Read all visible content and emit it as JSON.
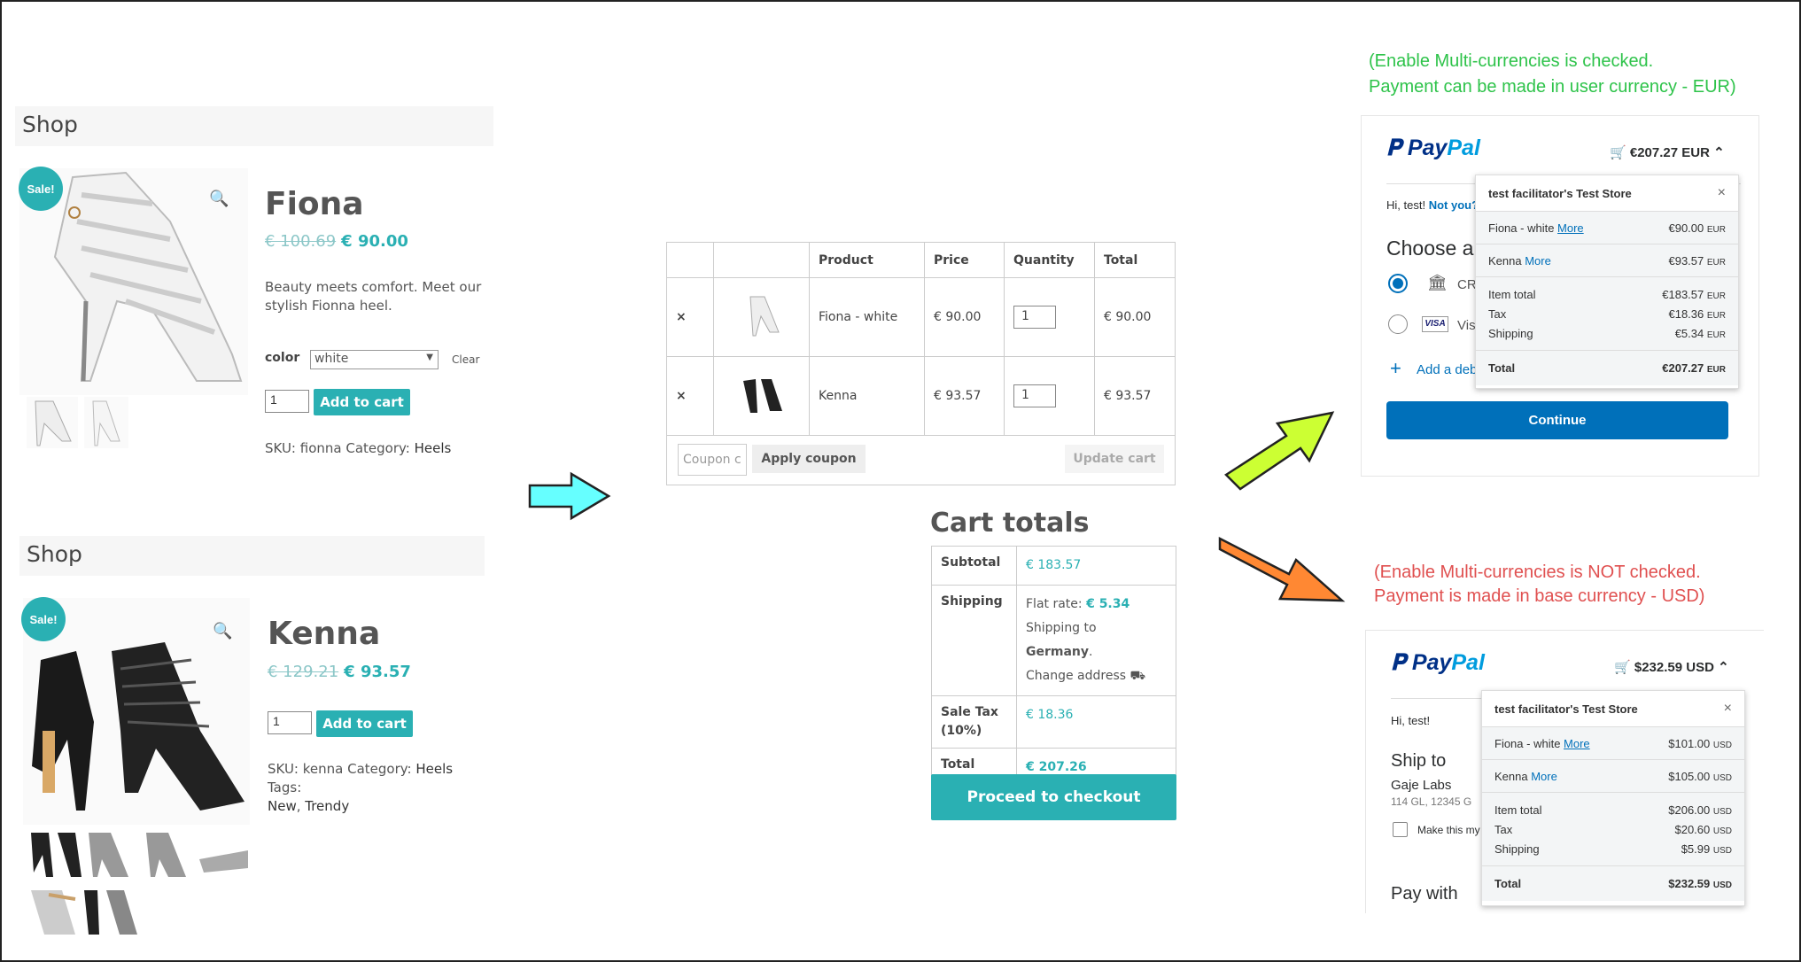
{
  "shop1": {
    "header": "Shop",
    "sale": "Sale!",
    "title": "Fiona",
    "old_price": "€ 100.69",
    "new_price": "€ 90.00",
    "description": "Beauty meets comfort. Meet our stylish Fionna heel.",
    "color_label": "color",
    "color_value": "white",
    "clear": "Clear",
    "qty": "1",
    "add_to_cart": "Add to cart",
    "sku_label": "SKU: ",
    "sku": "fionna",
    "category_label": " Category: ",
    "category": "Heels"
  },
  "shop2": {
    "header": "Shop",
    "sale": "Sale!",
    "title": "Kenna",
    "old_price": "€ 129.21",
    "new_price": "€ 93.57",
    "qty": "1",
    "add_to_cart": "Add to cart",
    "sku_label": "SKU: ",
    "sku": "kenna",
    "category_label": " Category: ",
    "category": "Heels",
    "tags_label": " Tags:",
    "tag1": "New",
    "tag2": "Trendy"
  },
  "cart": {
    "headers": [
      "",
      "",
      "Product",
      "Price",
      "Quantity",
      "Total"
    ],
    "rows": [
      {
        "name": "Fiona - white",
        "price": "€ 90.00",
        "qty": "1",
        "total": "€ 90.00"
      },
      {
        "name": "Kenna",
        "price": "€ 93.57",
        "qty": "1",
        "total": "€ 93.57"
      }
    ],
    "remove": "×",
    "coupon_placeholder": "Coupon c",
    "apply_coupon": "Apply coupon",
    "update_cart": "Update cart"
  },
  "totals": {
    "title": "Cart totals",
    "subtotal_label": "Subtotal",
    "subtotal": "€ 183.57",
    "shipping_label": "Shipping",
    "flat_rate_label": "Flat rate: ",
    "flat_rate": "€ 5.34",
    "shipping_to": "Shipping to ",
    "country": "Germany",
    "change_address": "Change address",
    "tax_label": "Sale Tax (10%)",
    "tax": "€ 18.36",
    "total_label": "Total",
    "total": "€ 207.26",
    "checkout": "Proceed to checkout"
  },
  "note_eur": {
    "line1": "(Enable Multi-currencies is checked.",
    "line2": "Payment can be made in user currency - EUR)"
  },
  "note_usd": {
    "line1": "(Enable Multi-currencies is NOT checked.",
    "line2": "Payment is made in base currency - USD)"
  },
  "paypal_eur": {
    "logo1": "Pay",
    "logo2": "Pal",
    "amount": "€207.27 EUR",
    "greeting": "Hi, test!",
    "not_you": "Not you?",
    "choose": "Choose a",
    "opt1": "CR",
    "opt2": "Vis",
    "add": "Add a deb",
    "continue": "Continue",
    "store": "test facilitator's Test Store",
    "items": [
      {
        "name": "Fiona - white",
        "more": "More",
        "price": "€90.00",
        "cur": "EUR"
      },
      {
        "name": "Kenna",
        "more": "More",
        "price": "€93.57",
        "cur": "EUR"
      }
    ],
    "item_total_label": "Item total",
    "item_total": "€183.57",
    "tax_label": "Tax",
    "tax": "€18.36",
    "shipping_label": "Shipping",
    "shipping": "€5.34",
    "total_label": "Total",
    "total": "€207.27",
    "cur": "EUR"
  },
  "paypal_usd": {
    "logo1": "Pay",
    "logo2": "Pal",
    "amount": "$232.59 USD",
    "greeting": "Hi, test!",
    "ship_to": "Ship to",
    "name": "Gaje Labs",
    "addr": "114 GL, 12345 G",
    "make_this": "Make this my",
    "pay_with": "Pay with",
    "store": "test facilitator's Test Store",
    "items": [
      {
        "name": "Fiona - white",
        "more": "More",
        "price": "$101.00",
        "cur": "USD"
      },
      {
        "name": "Kenna",
        "more": "More",
        "price": "$105.00",
        "cur": "USD"
      }
    ],
    "item_total_label": "Item total",
    "item_total": "$206.00",
    "tax_label": "Tax",
    "tax": "$20.60",
    "shipping_label": "Shipping",
    "shipping": "$5.99",
    "total_label": "Total",
    "total": "$232.59",
    "cur": "USD"
  },
  "colors": {
    "teal": "#2ab0b3",
    "paypal_blue": "#0070ba",
    "arrow_cyan": "#66ffff",
    "arrow_lime": "#ccff33",
    "arrow_orange": "#ff8833"
  }
}
